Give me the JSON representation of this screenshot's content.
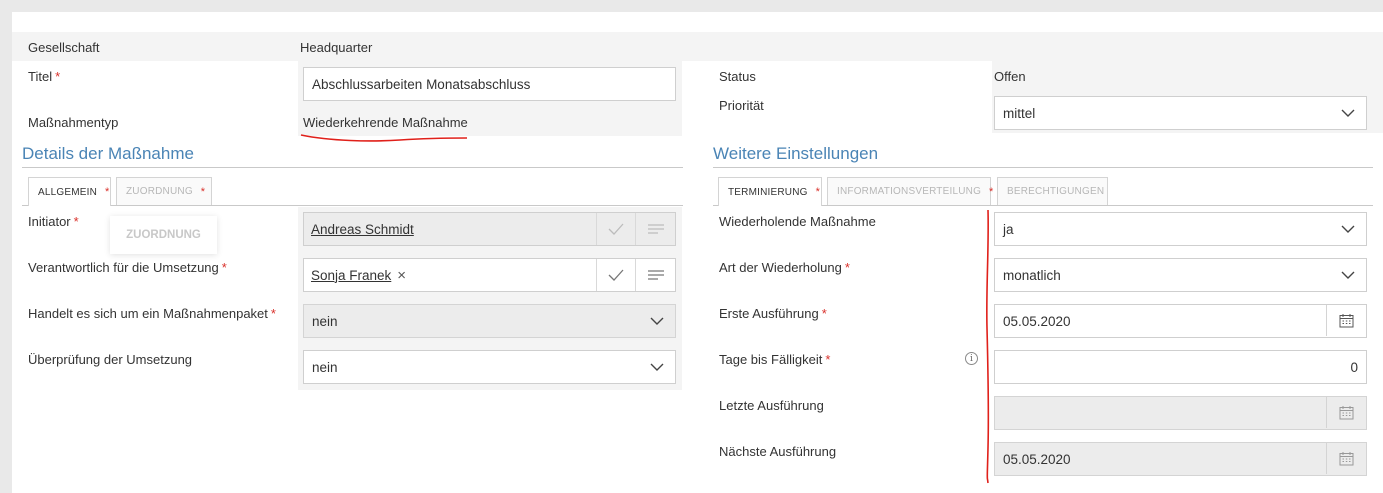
{
  "header": {
    "company_label": "Gesellschaft",
    "company_value": "Headquarter",
    "title_label": "Titel",
    "title_value": "Abschlussarbeiten Monatsabschluss",
    "type_label": "Maßnahmentyp",
    "type_value": "Wiederkehrende Maßnahme",
    "status_label": "Status",
    "status_value": "Offen",
    "priority_label": "Priorität",
    "priority_value": "mittel",
    "required_mark": "*"
  },
  "details": {
    "section_title": "Details der Maßnahme",
    "tabs": [
      {
        "label": "ALLGEMEIN",
        "active": true
      },
      {
        "label": "ZUORDNUNG",
        "active": false
      }
    ],
    "drag_ghost_label": "ZUORDNUNG",
    "initiator_label": "Initiator",
    "initiator_value": "Andreas Schmidt",
    "responsible_label": "Verantwortlich für die Umsetzung",
    "responsible_value": "Sonja Franek",
    "remove_glyph": "×",
    "package_label": "Handelt es sich um ein Maßnahmenpaket",
    "package_value": "nein",
    "review_label": "Überprüfung der Umsetzung",
    "review_value": "nein"
  },
  "settings": {
    "section_title": "Weitere Einstellungen",
    "tabs": [
      {
        "label": "TERMINIERUNG",
        "active": true
      },
      {
        "label": "INFORMATIONSVERTEILUNG",
        "active": false
      },
      {
        "label": "BERECHTIGUNGEN",
        "active": false
      }
    ],
    "recurring_label": "Wiederholende Maßnahme",
    "recurring_value": "ja",
    "repeat_type_label": "Art der Wiederholung",
    "repeat_type_value": "monatlich",
    "first_run_label": "Erste Ausführung",
    "first_run_value": "05.05.2020",
    "days_due_label": "Tage bis Fälligkeit",
    "days_due_value": "0",
    "info_glyph": "i",
    "last_run_label": "Letzte Ausführung",
    "last_run_value": "",
    "next_run_label": "Nächste Ausführung",
    "next_run_value": "05.05.2020"
  },
  "colors": {
    "section_title": "#4a84b5",
    "required": "#d9302a",
    "annotation": "#e0201a"
  },
  "icons": [
    "check-icon",
    "list-icon",
    "chevron-down-icon",
    "calendar-icon",
    "info-icon",
    "close-icon"
  ]
}
